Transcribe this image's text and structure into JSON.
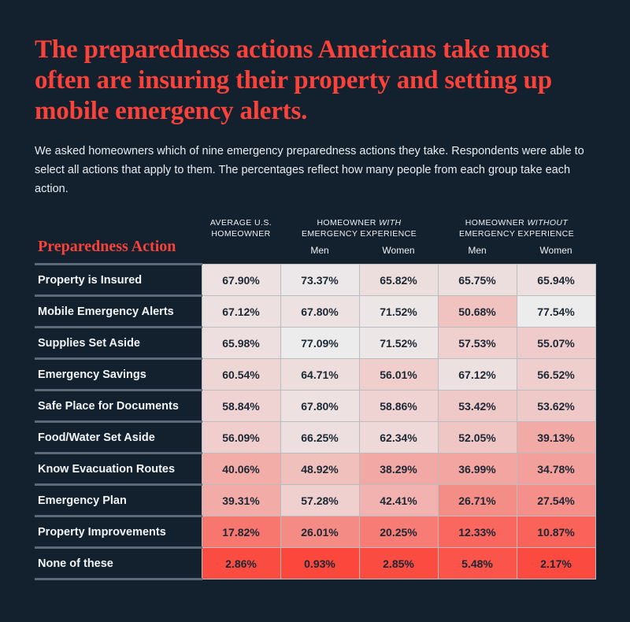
{
  "theme": {
    "background": "#13202e",
    "accent_red": "#f9423a",
    "text_light": "#f2f5f8",
    "heat_min_color": "#ffffff",
    "heat_max_color": "#fc4439"
  },
  "headline": "The preparedness actions Americans take most often are insuring their property and setting up mobile emergency alerts.",
  "subhead": "We asked homeowners which of nine emergency preparedness actions they take. Respondents were able to select all actions that apply to them. The percentages reflect how many people from each group take each action.",
  "table": {
    "corner_header": "Preparedness Action",
    "group_headers": [
      {
        "line1": "AVERAGE U.S.",
        "line1_italic": "",
        "line2": "HOMEOWNER",
        "span": 1
      },
      {
        "line1": "HOMEOWNER ",
        "line1_italic": "WITH",
        "line2": "EMERGENCY EXPERIENCE",
        "span": 2
      },
      {
        "line1": "HOMEOWNER ",
        "line1_italic": "WITHOUT",
        "line2": "EMERGENCY EXPERIENCE",
        "span": 2
      }
    ],
    "sub_headers": [
      "",
      "Men",
      "Women",
      "Men",
      "Women"
    ],
    "columns": [
      "AVERAGE U.S. HOMEOWNER",
      "HOMEOWNER WITH EMERGENCY EXPERIENCE - Men",
      "HOMEOWNER WITH EMERGENCY EXPERIENCE - Women",
      "HOMEOWNER WITHOUT EMERGENCY EXPERIENCE - Men",
      "HOMEOWNER WITHOUT EMERGENCY EXPERIENCE - Women"
    ],
    "rows": [
      {
        "label": "Property is Insured",
        "values": [
          "67.90%",
          "73.37%",
          "65.82%",
          "65.75%",
          "65.94%"
        ],
        "numeric": [
          67.9,
          73.37,
          65.82,
          65.75,
          65.94
        ]
      },
      {
        "label": "Mobile Emergency Alerts",
        "values": [
          "67.12%",
          "67.80%",
          "71.52%",
          "50.68%",
          "77.54%"
        ],
        "numeric": [
          67.12,
          67.8,
          71.52,
          50.68,
          77.54
        ]
      },
      {
        "label": "Supplies Set Aside",
        "values": [
          "65.98%",
          "77.09%",
          "71.52%",
          "57.53%",
          "55.07%"
        ],
        "numeric": [
          65.98,
          77.09,
          71.52,
          57.53,
          55.07
        ]
      },
      {
        "label": "Emergency Savings",
        "values": [
          "60.54%",
          "64.71%",
          "56.01%",
          "67.12%",
          "56.52%"
        ],
        "numeric": [
          60.54,
          64.71,
          56.01,
          67.12,
          56.52
        ]
      },
      {
        "label": "Safe Place for Documents",
        "values": [
          "58.84%",
          "67.80%",
          "58.86%",
          "53.42%",
          "53.62%"
        ],
        "numeric": [
          58.84,
          67.8,
          58.86,
          53.42,
          53.62
        ]
      },
      {
        "label": "Food/Water Set Aside",
        "values": [
          "56.09%",
          "66.25%",
          "62.34%",
          "52.05%",
          "39.13%"
        ],
        "numeric": [
          56.09,
          66.25,
          62.34,
          52.05,
          39.13
        ]
      },
      {
        "label": "Know Evacuation Routes",
        "values": [
          "40.06%",
          "48.92%",
          "38.29%",
          "36.99%",
          "34.78%"
        ],
        "numeric": [
          40.06,
          48.92,
          38.29,
          36.99,
          34.78
        ]
      },
      {
        "label": "Emergency Plan",
        "values": [
          "39.31%",
          "57.28%",
          "42.41%",
          "26.71%",
          "27.54%"
        ],
        "numeric": [
          39.31,
          57.28,
          42.41,
          26.71,
          27.54
        ]
      },
      {
        "label": "Property Improvements",
        "values": [
          "17.82%",
          "26.01%",
          "20.25%",
          "12.33%",
          "10.87%"
        ],
        "numeric": [
          17.82,
          26.01,
          20.25,
          12.33,
          10.87
        ]
      },
      {
        "label": "None of these",
        "values": [
          "2.86%",
          "0.93%",
          "2.85%",
          "5.48%",
          "2.17%"
        ],
        "numeric": [
          2.86,
          0.93,
          2.85,
          5.48,
          2.17
        ]
      }
    ]
  },
  "chart_data": {
    "type": "heatmap",
    "title": "The preparedness actions Americans take most often are insuring their property and setting up mobile emergency alerts.",
    "subtitle": "We asked homeowners which of nine emergency preparedness actions they take. Respondents were able to select all actions that apply to them. The percentages reflect how many people from each group take each action.",
    "xlabel": "",
    "ylabel": "Preparedness Action",
    "unit": "percent",
    "categories_x": [
      "AVERAGE U.S. HOMEOWNER",
      "HOMEOWNER WITH EMERGENCY EXPERIENCE - Men",
      "HOMEOWNER WITH EMERGENCY EXPERIENCE - Women",
      "HOMEOWNER WITHOUT EMERGENCY EXPERIENCE - Men",
      "HOMEOWNER WITHOUT EMERGENCY EXPERIENCE - Women"
    ],
    "categories_y": [
      "Property is Insured",
      "Mobile Emergency Alerts",
      "Supplies Set Aside",
      "Emergency Savings",
      "Safe Place for Documents",
      "Food/Water Set Aside",
      "Know Evacuation Routes",
      "Emergency Plan",
      "Property Improvements",
      "None of these"
    ],
    "values": [
      [
        67.9,
        73.37,
        65.82,
        65.75,
        65.94
      ],
      [
        67.12,
        67.8,
        71.52,
        50.68,
        77.54
      ],
      [
        65.98,
        77.09,
        71.52,
        57.53,
        55.07
      ],
      [
        60.54,
        64.71,
        56.01,
        67.12,
        56.52
      ],
      [
        58.84,
        67.8,
        58.86,
        53.42,
        53.62
      ],
      [
        56.09,
        66.25,
        62.34,
        52.05,
        39.13
      ],
      [
        40.06,
        48.92,
        38.29,
        36.99,
        34.78
      ],
      [
        39.31,
        57.28,
        42.41,
        26.71,
        27.54
      ],
      [
        17.82,
        26.01,
        20.25,
        12.33,
        10.87
      ],
      [
        2.86,
        0.93,
        2.85,
        5.48,
        2.17
      ]
    ],
    "color_scale": {
      "low_value_color": "#fc4439",
      "high_value_color": "#ffffff",
      "vmin": 0,
      "vmax": 78
    },
    "legend": "none",
    "grid": true
  }
}
